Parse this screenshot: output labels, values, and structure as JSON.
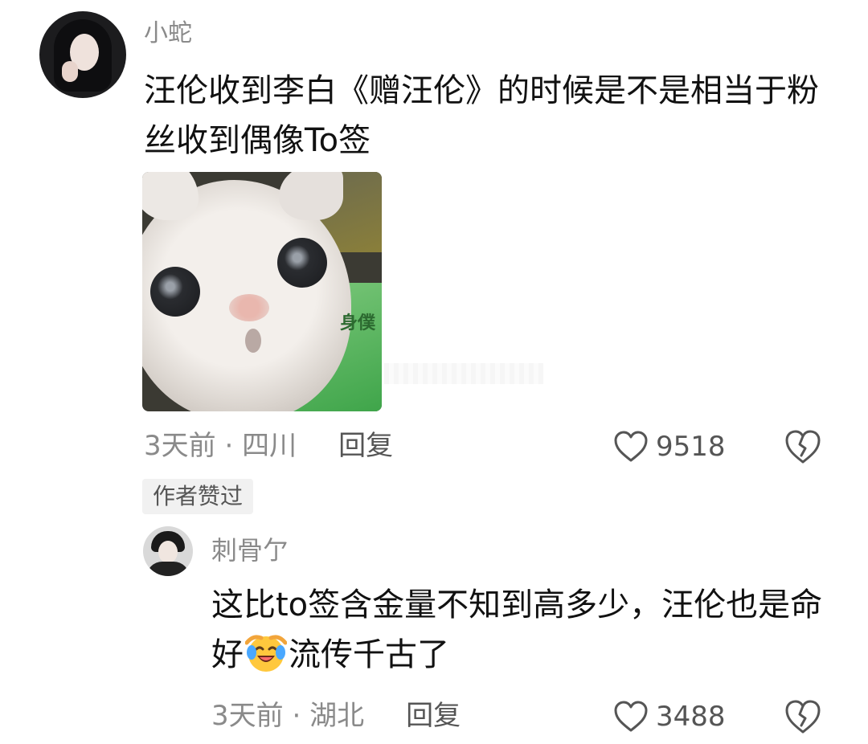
{
  "comment": {
    "username": "小蛇",
    "content": "汪伦收到李白《赠汪伦》的时候是不是相当于粉丝收到偶像To签",
    "time": "3天前",
    "separator": " · ",
    "location": "四川",
    "reply_label": "回复",
    "likes": "9518",
    "author_liked_badge": "作者赞过",
    "sticker_sign_text": "身僕"
  },
  "reply": {
    "username": "刺骨亇",
    "content_before_emoji": "这比to签含金量不知到高多少，汪伦也是命好",
    "emoji": "laughing-tears-emoji",
    "content_after_emoji": "流传千古了",
    "time": "3天前",
    "separator": " · ",
    "location": "湖北",
    "reply_label": "回复",
    "likes": "3488"
  },
  "colors": {
    "text_primary": "#111111",
    "text_secondary": "#8a8a8a",
    "badge_bg": "#f1f1f1",
    "icon_stroke": "#555555"
  }
}
